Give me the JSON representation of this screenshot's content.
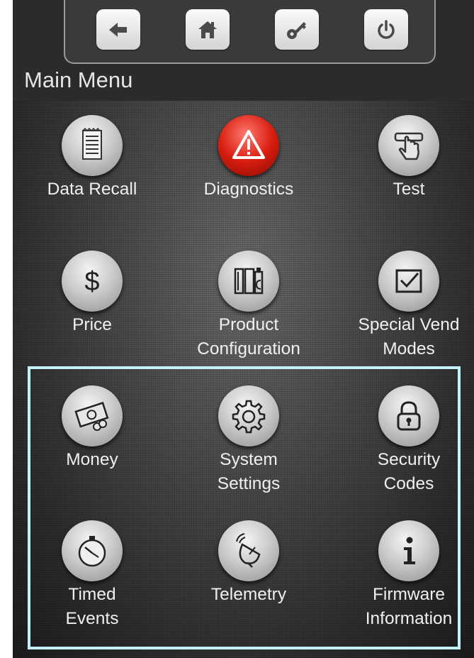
{
  "screen": {
    "title": "Main Menu"
  },
  "nav": [
    {
      "name": "back-button",
      "icon": "arrow-left-icon"
    },
    {
      "name": "home-button",
      "icon": "home-icon"
    },
    {
      "name": "key-button",
      "icon": "key-icon"
    },
    {
      "name": "power-button",
      "icon": "power-icon"
    }
  ],
  "menu": {
    "data_recall": {
      "label": "Data Recall",
      "icon": "notepad-icon"
    },
    "diagnostics": {
      "label": "Diagnostics",
      "icon": "warning-icon",
      "color": "#d81e10"
    },
    "test": {
      "label": "Test",
      "icon": "hand-press-icon"
    },
    "price": {
      "label": "Price",
      "icon": "dollar-icon"
    },
    "product_configuration": {
      "label": "Product\nConfiguration",
      "icon": "products-icon"
    },
    "special_vend_modes": {
      "label": "Special Vend\nModes",
      "icon": "checkbox-icon"
    },
    "money": {
      "label": "Money",
      "icon": "money-icon"
    },
    "system_settings": {
      "label": "System\nSettings",
      "icon": "gear-icon"
    },
    "security_codes": {
      "label": "Security\nCodes",
      "icon": "padlock-icon"
    },
    "timed_events": {
      "label": "Timed\nEvents",
      "icon": "stopwatch-icon"
    },
    "telemetry": {
      "label": "Telemetry",
      "icon": "satellite-dish-icon"
    },
    "firmware_information": {
      "label": "Firmware\nInformation",
      "icon": "info-icon"
    }
  },
  "colors": {
    "highlight_border": "#c4f1f7",
    "background": "#3c3c3c",
    "text": "#f0f0f0"
  }
}
